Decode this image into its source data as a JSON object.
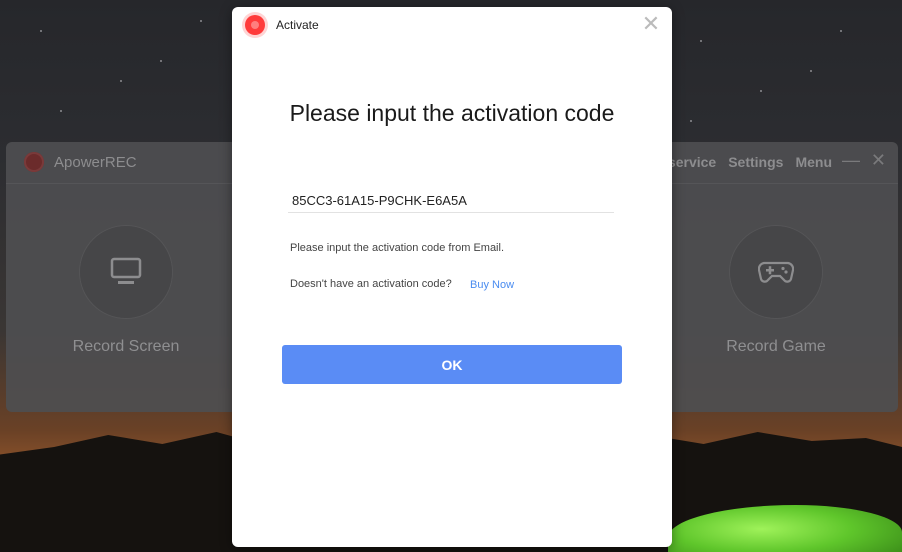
{
  "background_app": {
    "title": "ApowerREC",
    "menu": [
      "service",
      "Settings",
      "Menu"
    ],
    "minimize_glyph": "—",
    "close_glyph": "✕",
    "features": [
      {
        "label": "Record Screen",
        "icon": "monitor-icon"
      },
      {
        "label": "Record Game",
        "icon": "gamepad-icon"
      }
    ]
  },
  "dialog": {
    "title": "Activate",
    "close_glyph": "✕",
    "heading": "Please input the activation code",
    "code_value": "85CC3-61A15-P9CHK-E6A5A",
    "hint": "Please input the activation code from Email.",
    "no_code_text": "Doesn't have an activation code?",
    "buy_now_label": "Buy Now",
    "ok_label": "OK"
  },
  "colors": {
    "accent": "#5a8cf5",
    "link": "#4a8cf0",
    "logo": "#ff3b3b"
  }
}
